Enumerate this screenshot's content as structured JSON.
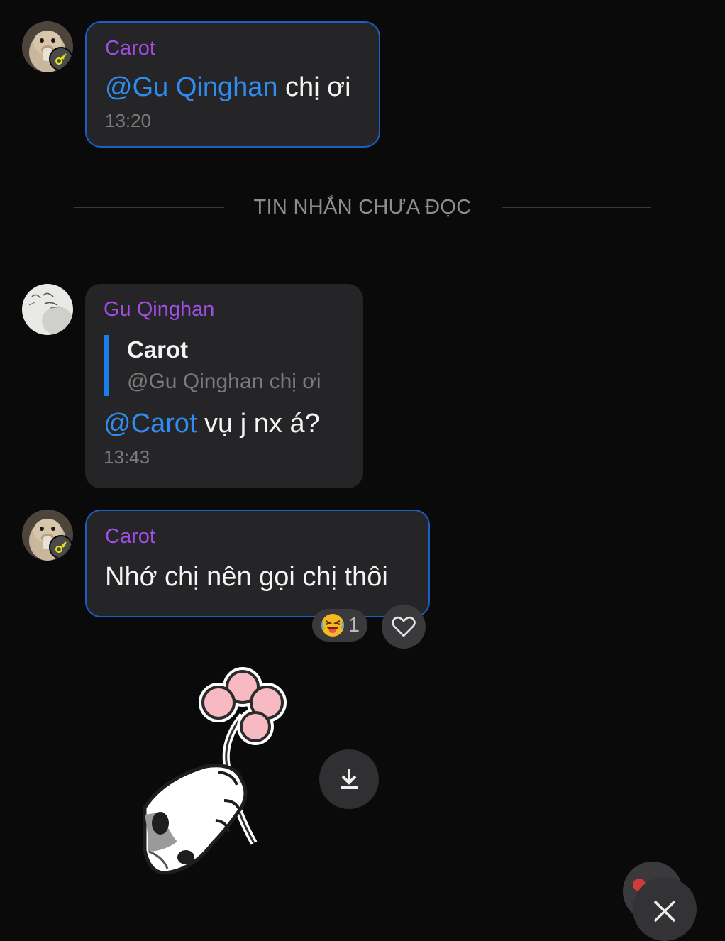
{
  "messages": [
    {
      "sender": "Carot",
      "mention": "@Gu Qinghan",
      "text": " chị ơi",
      "time": "13:20"
    },
    {
      "sender": "Gu Qinghan",
      "quote": {
        "name": "Carot",
        "text": "@Gu Qinghan chị ơi"
      },
      "mention": "@Carot",
      "text": " vụ j nx á?",
      "time": "13:43"
    },
    {
      "sender": "Carot",
      "text": "Nhớ chị nên gọi chị thôi",
      "reaction": {
        "icon": "laughing-emoji-icon",
        "count": "1"
      }
    }
  ],
  "divider": {
    "label": "TIN NHẮN CHƯA ĐỌC"
  },
  "colors": {
    "background": "#0a0a0a",
    "bubble": "#252528",
    "sender": "#a14ee6",
    "mention": "#2f8cf0",
    "own_border": "#1c5fc4",
    "timestamp": "#7c7c7c"
  },
  "icons": {
    "heart": "heart-outline-icon",
    "download": "download-icon",
    "sticker": "hand-holding-flower-sticker",
    "close": "close-icon"
  }
}
